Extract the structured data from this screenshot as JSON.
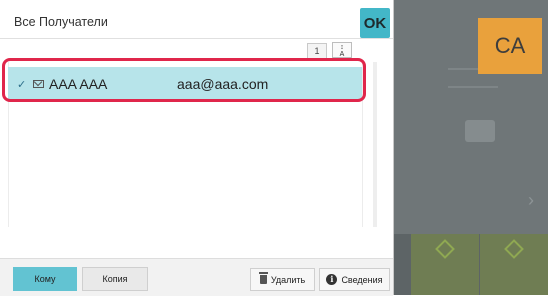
{
  "dialog": {
    "title": "Все Получатели",
    "ok_label": "OK",
    "page_number": "1",
    "sort_icon": "sort-az-icon",
    "recipients": [
      {
        "name": "AAA AAA",
        "email": "aaa@aaa.com",
        "selected": true,
        "check": "✓",
        "icon": "mail-icon"
      }
    ],
    "highlight_color": "#e0264b",
    "row_color": "#b7e4ea"
  },
  "bottom": {
    "to_label": "Кому",
    "cc_label": "Копия",
    "delete_label": "Удалить",
    "info_label": "Сведения",
    "info_glyph": "i"
  },
  "background": {
    "ca_label": "CA",
    "ca_color": "#e9a13c",
    "accent_color": "#43b7c8"
  }
}
